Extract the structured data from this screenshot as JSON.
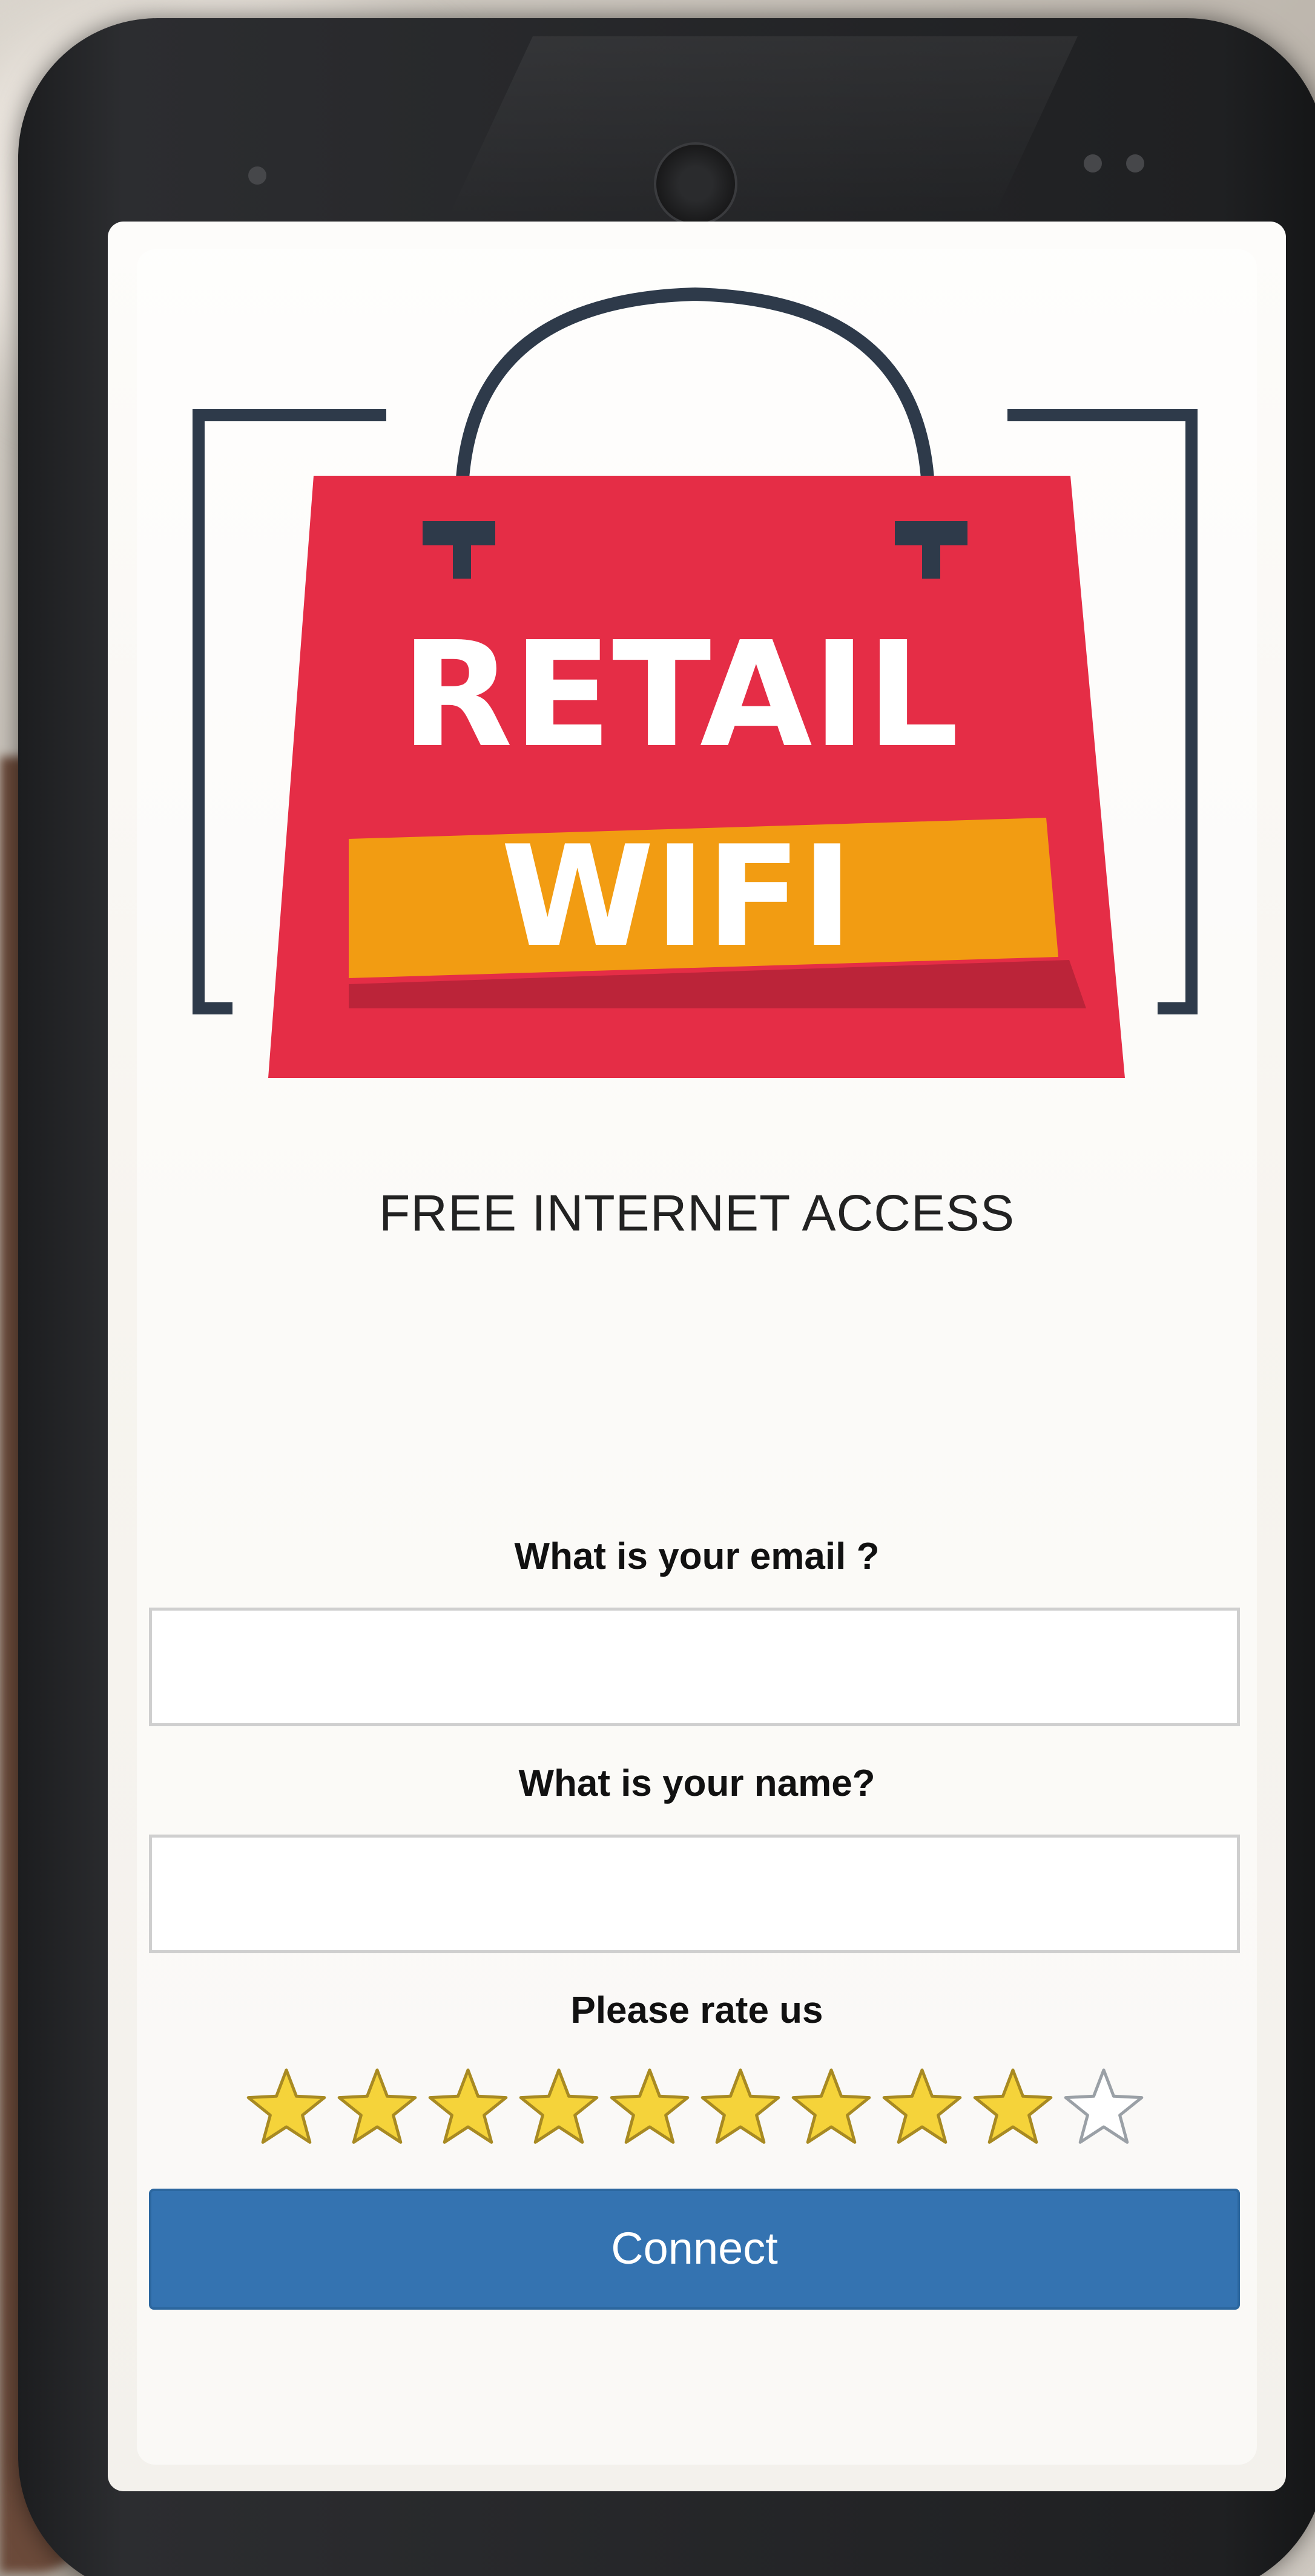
{
  "brand": {
    "line1": "RETAIL",
    "line2": "WIFI",
    "colors": {
      "bag": "#e52d46",
      "banner": "#f29c12",
      "handle": "#2e3a4a"
    }
  },
  "tagline": "FREE INTERNET ACCESS",
  "form": {
    "email_label": "What is your email ?",
    "email_value": "",
    "name_label": "What is your name?",
    "name_value": "",
    "rating_label": "Please rate us",
    "rating": {
      "filled": 9,
      "max": 10
    },
    "submit_label": "Connect"
  },
  "colors": {
    "accent": "#3473b1",
    "star_filled": "#f5d33a",
    "star_empty": "#ffffff"
  }
}
